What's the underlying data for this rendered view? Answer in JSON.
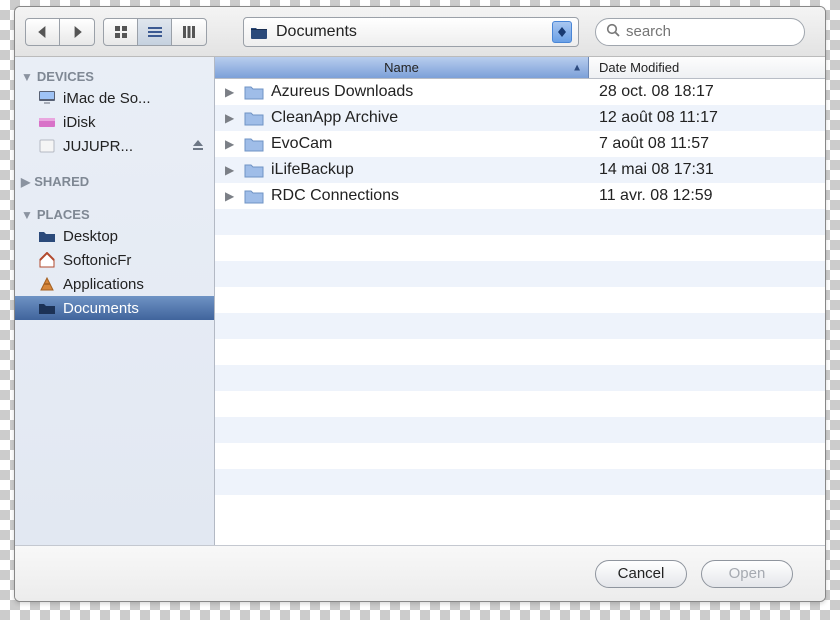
{
  "toolbar": {
    "location_label": "Documents",
    "search_placeholder": "search",
    "view_mode_active": "list"
  },
  "columns": {
    "name": "Name",
    "date": "Date Modified",
    "sort_dir": "asc"
  },
  "sidebar": {
    "groups": [
      {
        "id": "devices",
        "header": "DEVICES",
        "expanded": true,
        "items": [
          {
            "id": "imac",
            "label": "iMac de So...",
            "icon": "imac-icon"
          },
          {
            "id": "idisk",
            "label": "iDisk",
            "icon": "idisk-icon"
          },
          {
            "id": "jujupr",
            "label": "JUJUPR...",
            "icon": "drive-icon",
            "ejectable": true
          }
        ]
      },
      {
        "id": "shared",
        "header": "SHARED",
        "expanded": false,
        "items": []
      },
      {
        "id": "places",
        "header": "PLACES",
        "expanded": true,
        "items": [
          {
            "id": "desktop",
            "label": "Desktop",
            "icon": "desktop-folder-icon"
          },
          {
            "id": "softonicfr",
            "label": "SoftonicFr",
            "icon": "home-icon"
          },
          {
            "id": "applications",
            "label": "Applications",
            "icon": "applications-icon"
          },
          {
            "id": "documents",
            "label": "Documents",
            "icon": "documents-folder-icon",
            "selected": true
          }
        ]
      }
    ]
  },
  "rows": [
    {
      "name": "Azureus Downloads",
      "date": "28 oct. 08 18:17"
    },
    {
      "name": "CleanApp Archive",
      "date": "12 août 08 11:17"
    },
    {
      "name": "EvoCam",
      "date": "7 août 08 11:57"
    },
    {
      "name": "iLifeBackup",
      "date": "14 mai 08 17:31"
    },
    {
      "name": "RDC Connections",
      "date": "11 avr. 08 12:59"
    }
  ],
  "footer": {
    "cancel": "Cancel",
    "open": "Open",
    "open_enabled": false
  },
  "colors": {
    "selection_top": "#6f93c4",
    "selection_bottom": "#40649c",
    "header_sort_top": "#b8cdee",
    "header_sort_bottom": "#7ca0d8",
    "row_alt": "#eef3fb"
  }
}
